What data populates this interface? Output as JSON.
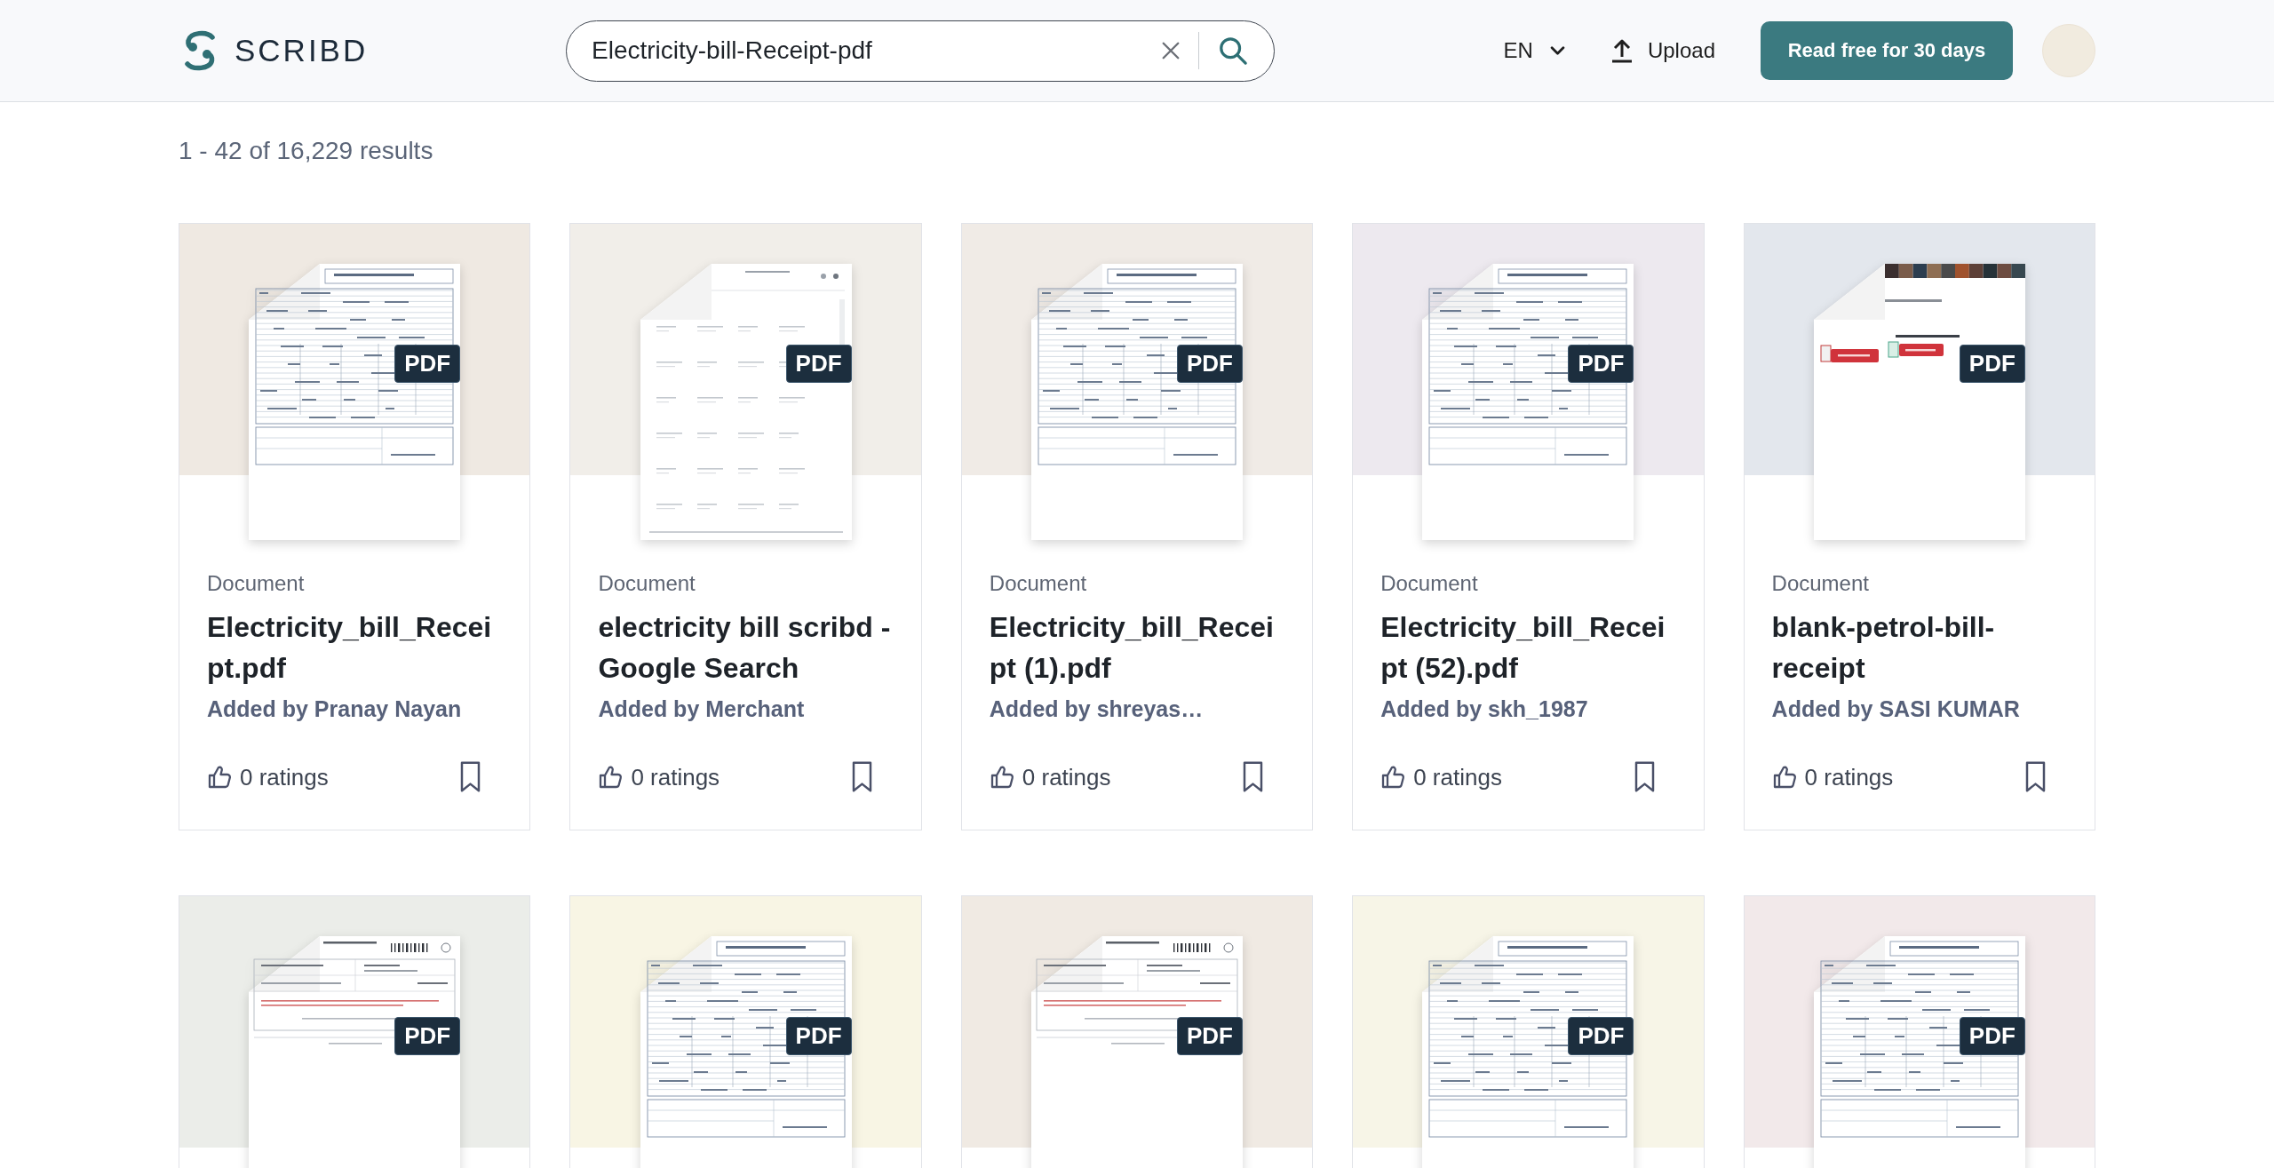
{
  "header": {
    "logo": "SCRIBD",
    "search": {
      "value": "Electricity-bill-Receipt-pdf"
    },
    "language": "EN",
    "upload": "Upload",
    "cta": "Read free for 30 days"
  },
  "results_summary": "1 - 42 of 16,229 results",
  "results": [
    {
      "kind": "table",
      "color": "#efe9e2",
      "badge": "PDF",
      "type": "Document",
      "title": "Electricity_bill_Receipt.pdf",
      "author": "Added by Pranay Nayan",
      "ratings": "0 ratings",
      "bookmarked": false
    },
    {
      "kind": "sparse",
      "color": "#f1eee9",
      "badge": "PDF",
      "type": "Document",
      "title": "electricity bill scribd - Google Search",
      "author": "Added by Merchant",
      "ratings": "0 ratings",
      "bookmarked": false
    },
    {
      "kind": "table",
      "color": "#f0ebe6",
      "badge": "PDF",
      "type": "Document",
      "title": "Electricity_bill_Receipt (1).pdf",
      "author": "Added by shreyas…",
      "ratings": "0 ratings",
      "bookmarked": false
    },
    {
      "kind": "table",
      "color": "#ede9ef",
      "badge": "PDF",
      "type": "Document",
      "title": "Electricity_bill_Receipt (52).pdf",
      "author": "Added by skh_1987",
      "ratings": "0 ratings",
      "bookmarked": false
    },
    {
      "kind": "buttons",
      "color": "#e3e7ed",
      "badge": "PDF",
      "type": "Document",
      "title": "blank-petrol-bill-receipt",
      "author": "Added by SASI KUMAR",
      "ratings": "0 ratings",
      "bookmarked": false
    },
    {
      "kind": "form",
      "color": "#ebede9",
      "badge": "PDF"
    },
    {
      "kind": "table",
      "color": "#f8f5e4",
      "badge": "PDF"
    },
    {
      "kind": "form",
      "color": "#f0eae3",
      "badge": "PDF"
    },
    {
      "kind": "table",
      "color": "#f7f5e7",
      "badge": "PDF"
    },
    {
      "kind": "table",
      "color": "#f2e9ea",
      "badge": "PDF"
    }
  ]
}
